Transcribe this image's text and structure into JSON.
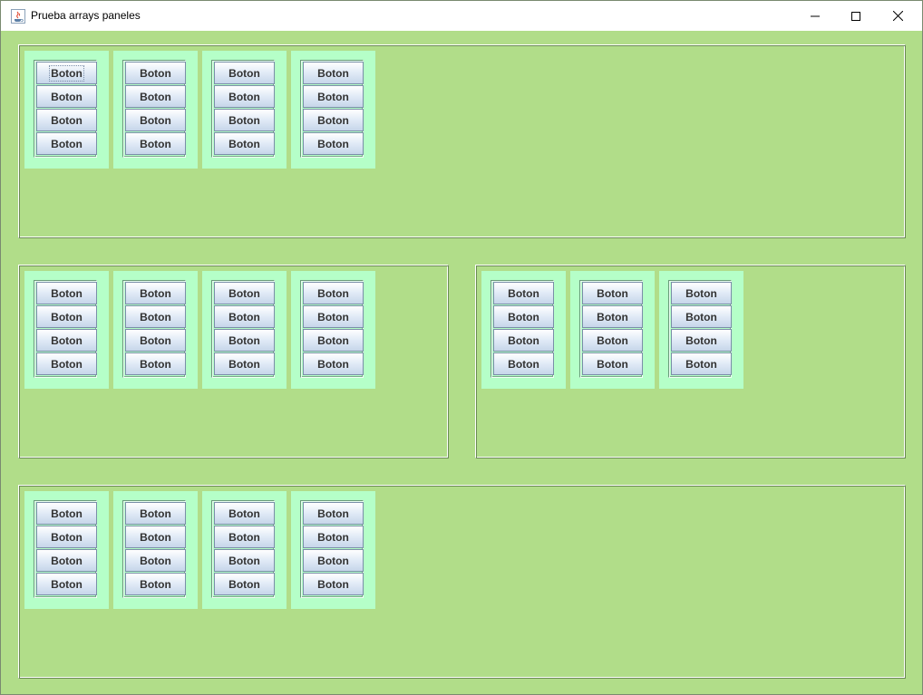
{
  "window": {
    "title": "Prueba arrays paneles"
  },
  "colors": {
    "background": "#b1dd89",
    "cell": "#b5ffc8",
    "button_border": "#7a8ea8"
  },
  "icons": {
    "app": "java-icon",
    "minimize": "minimize-icon",
    "maximize": "maximize-icon",
    "close": "close-icon"
  },
  "button_label": "Boton",
  "panels": [
    {
      "name": "panel-top",
      "cells": 4
    },
    {
      "name": "panel-middle-left",
      "cells": 4
    },
    {
      "name": "panel-middle-right",
      "cells": 3
    },
    {
      "name": "panel-bottom",
      "cells": 4
    }
  ],
  "buttons_per_cell": 4
}
